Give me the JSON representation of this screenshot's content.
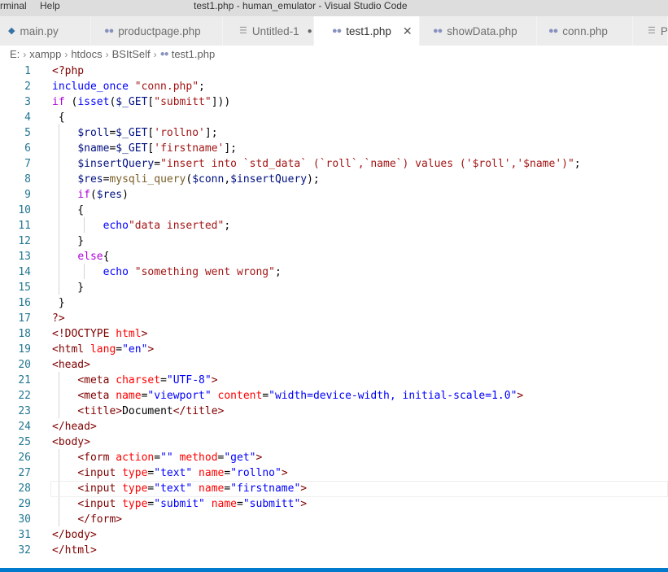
{
  "titlebar": {
    "menu": [
      "rminal",
      "Help"
    ],
    "window_title": "test1.php - human_emulator - Visual Studio Code"
  },
  "tabs": [
    {
      "label": "main.py",
      "icon": "python-icon",
      "state": "normal"
    },
    {
      "label": "productpage.php",
      "icon": "php-icon",
      "state": "normal"
    },
    {
      "label": "Untitled-1",
      "icon": "text-file-icon",
      "state": "modified"
    },
    {
      "label": "test1.php",
      "icon": "php-icon",
      "state": "active"
    },
    {
      "label": "showData.php",
      "icon": "php-icon",
      "state": "normal"
    },
    {
      "label": "conn.php",
      "icon": "php-icon",
      "state": "normal"
    },
    {
      "label": "Py",
      "icon": "text-file-icon",
      "state": "normal"
    }
  ],
  "breadcrumb": [
    "E:",
    "xampp",
    "htdocs",
    "BSItSelf",
    "test1.php"
  ],
  "editor": {
    "current_line": 28,
    "lines": [
      "<?php",
      "include_once \"conn.php\";",
      "if (isset($_GET[\"submitt\"]))",
      " {",
      "    $roll=$_GET['rollno'];",
      "    $name=$_GET['firstname'];",
      "    $insertQuery=\"insert into `std_data` (`roll`,`name`) values ('$roll','$name')\";",
      "    $res=mysqli_query($conn,$insertQuery);",
      "    if($res)",
      "    {",
      "        echo\"data inserted\";",
      "    }",
      "    else{",
      "        echo \"something went wrong\";",
      "    }",
      " }",
      "?>",
      "<!DOCTYPE html>",
      "<html lang=\"en\">",
      "<head>",
      "    <meta charset=\"UTF-8\">",
      "    <meta name=\"viewport\" content=\"width=device-width, initial-scale=1.0\">",
      "    <title>Document</title>",
      "</head>",
      "<body>",
      "    <form action=\"\" method=\"get\">",
      "    <input type=\"text\" name=\"rollno\">",
      "    <input type=\"text\" name=\"firstname\">",
      "    <input type=\"submit\" name=\"submitt\">",
      "    </form>",
      "</body>",
      "</html>"
    ]
  },
  "colors": {
    "statusbar": "#007acc",
    "line_number": "#237893",
    "keyword": "#0000ff",
    "string": "#a31515",
    "tag": "#800000",
    "attribute": "#ff0000"
  }
}
